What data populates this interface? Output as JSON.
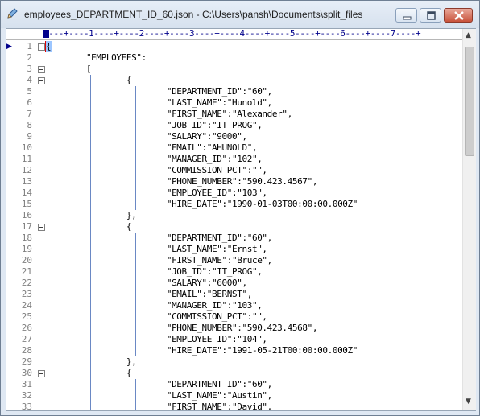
{
  "window": {
    "title": "employees_DEPARTMENT_ID_60.json - C:\\Users\\pansh\\Documents\\split_files",
    "icons": {
      "app": "pencil-icon",
      "minimize": "minimize-icon",
      "maximize": "maximize-icon",
      "close": "close-icon"
    }
  },
  "ruler": {
    "text": "----+----1----+----2----+----3----+----4----+----5----+----6----+----7----+"
  },
  "editor": {
    "current_line": 1,
    "lines": [
      {
        "n": "1",
        "text": "{",
        "fold": true
      },
      {
        "n": "2",
        "text": "        \"EMPLOYEES\":",
        "fold": false
      },
      {
        "n": "3",
        "text": "        [",
        "fold": true
      },
      {
        "n": "4",
        "text": "                {",
        "fold": true
      },
      {
        "n": "5",
        "text": "                        \"DEPARTMENT_ID\":\"60\",",
        "fold": false
      },
      {
        "n": "6",
        "text": "                        \"LAST_NAME\":\"Hunold\",",
        "fold": false
      },
      {
        "n": "7",
        "text": "                        \"FIRST_NAME\":\"Alexander\",",
        "fold": false
      },
      {
        "n": "8",
        "text": "                        \"JOB_ID\":\"IT_PROG\",",
        "fold": false
      },
      {
        "n": "9",
        "text": "                        \"SALARY\":\"9000\",",
        "fold": false
      },
      {
        "n": "10",
        "text": "                        \"EMAIL\":\"AHUNOLD\",",
        "fold": false
      },
      {
        "n": "11",
        "text": "                        \"MANAGER_ID\":\"102\",",
        "fold": false
      },
      {
        "n": "12",
        "text": "                        \"COMMISSION_PCT\":\"\",",
        "fold": false
      },
      {
        "n": "13",
        "text": "                        \"PHONE_NUMBER\":\"590.423.4567\",",
        "fold": false
      },
      {
        "n": "14",
        "text": "                        \"EMPLOYEE_ID\":\"103\",",
        "fold": false
      },
      {
        "n": "15",
        "text": "                        \"HIRE_DATE\":\"1990-01-03T00:00:00.000Z\"",
        "fold": false
      },
      {
        "n": "16",
        "text": "                },",
        "fold": false
      },
      {
        "n": "17",
        "text": "                {",
        "fold": true
      },
      {
        "n": "18",
        "text": "                        \"DEPARTMENT_ID\":\"60\",",
        "fold": false
      },
      {
        "n": "19",
        "text": "                        \"LAST_NAME\":\"Ernst\",",
        "fold": false
      },
      {
        "n": "20",
        "text": "                        \"FIRST_NAME\":\"Bruce\",",
        "fold": false
      },
      {
        "n": "21",
        "text": "                        \"JOB_ID\":\"IT_PROG\",",
        "fold": false
      },
      {
        "n": "22",
        "text": "                        \"SALARY\":\"6000\",",
        "fold": false
      },
      {
        "n": "23",
        "text": "                        \"EMAIL\":\"BERNST\",",
        "fold": false
      },
      {
        "n": "24",
        "text": "                        \"MANAGER_ID\":\"103\",",
        "fold": false
      },
      {
        "n": "25",
        "text": "                        \"COMMISSION_PCT\":\"\",",
        "fold": false
      },
      {
        "n": "26",
        "text": "                        \"PHONE_NUMBER\":\"590.423.4568\",",
        "fold": false
      },
      {
        "n": "27",
        "text": "                        \"EMPLOYEE_ID\":\"104\",",
        "fold": false
      },
      {
        "n": "28",
        "text": "                        \"HIRE_DATE\":\"1991-05-21T00:00:00.000Z\"",
        "fold": false
      },
      {
        "n": "29",
        "text": "                },",
        "fold": false
      },
      {
        "n": "30",
        "text": "                {",
        "fold": true
      },
      {
        "n": "31",
        "text": "                        \"DEPARTMENT_ID\":\"60\",",
        "fold": false
      },
      {
        "n": "32",
        "text": "                        \"LAST_NAME\":\"Austin\",",
        "fold": false
      },
      {
        "n": "33",
        "text": "                        \"FIRST_NAME\":\"David\",",
        "fold": false
      }
    ]
  }
}
